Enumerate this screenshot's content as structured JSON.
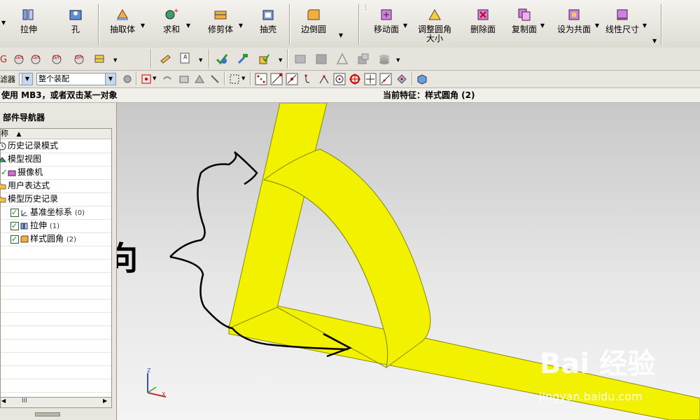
{
  "ribbon": {
    "buttons": [
      {
        "label": "拉伸",
        "icon": "extrude-icon"
      },
      {
        "label": "孔",
        "icon": "hole-icon"
      },
      {
        "label": "抽取体",
        "icon": "extract-body-icon"
      },
      {
        "label": "求和",
        "icon": "unite-icon"
      },
      {
        "label": "修剪体",
        "icon": "trim-body-icon"
      },
      {
        "label": "抽壳",
        "icon": "shell-icon"
      },
      {
        "label": "边倒圆",
        "icon": "edge-blend-icon"
      },
      {
        "label": "移动面",
        "icon": "move-face-icon"
      },
      {
        "label": "调整圆角大小",
        "icon": "resize-blend-icon"
      },
      {
        "label": "删除面",
        "icon": "delete-face-icon"
      },
      {
        "label": "复制面",
        "icon": "copy-face-icon"
      },
      {
        "label": "设为共面",
        "icon": "make-coplanar-icon"
      },
      {
        "label": "线性尺寸",
        "icon": "linear-dimension-icon"
      }
    ]
  },
  "selection_bar": {
    "filter_label": "滤器",
    "scope_value": "整个装配"
  },
  "status": {
    "prompt": "使用 MB3，或者双击某一对象",
    "current_feature": "当前特征：样式圆角 (2)"
  },
  "navigator": {
    "title": "部件导航器",
    "column_header": "称",
    "items": [
      {
        "label": "历史记录模式",
        "indent": 0
      },
      {
        "label": "模型视图",
        "indent": 0
      },
      {
        "label": "摄像机",
        "indent": 0
      },
      {
        "label": "用户表达式",
        "indent": 0
      },
      {
        "label": "模型历史记录",
        "indent": 0
      },
      {
        "label": "基准坐标系",
        "count": "(0)",
        "indent": 1
      },
      {
        "label": "拉伸",
        "count": "(1)",
        "indent": 1
      },
      {
        "label": "样式圆角",
        "count": "(2)",
        "indent": 1
      }
    ],
    "scroll_label": "III"
  },
  "viewport": {
    "annotation": "已经反向",
    "watermark_logo": "Bai 经验",
    "watermark_url": "jingyan.baidu.com",
    "axis_labels": {
      "z": "Z",
      "x": "X"
    }
  },
  "colors": {
    "part_yellow": "#f2f200",
    "part_edge": "#8a8a00"
  }
}
